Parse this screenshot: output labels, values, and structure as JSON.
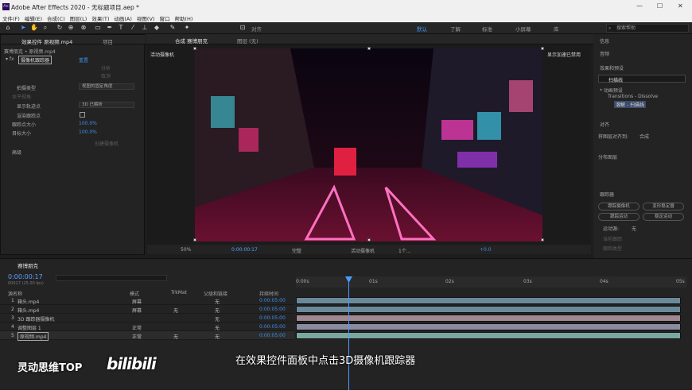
{
  "title": "Adobe After Effects 2020 - 无标题项目.aep *",
  "menu": [
    "文件(F)",
    "编辑(E)",
    "合成(C)",
    "图层(L)",
    "效果(T)",
    "动画(A)",
    "视图(V)",
    "窗口",
    "帮助(H)"
  ],
  "workspaces": [
    "默认",
    "了解",
    "标准",
    "小屏幕",
    "库"
  ],
  "search_placeholder": "搜索帮助",
  "toolbar_labels": {
    "align": "对齐"
  },
  "left_panel": {
    "tab_effects": "效果控件 原视频.mp4",
    "tab_project": "项目",
    "breadcrumb": "赛博朋克 • 原视频.mp4",
    "fx_name": "摄像机跟踪器",
    "reset": "重置",
    "lbl_analyze": "分析",
    "lbl_cancel": "取消",
    "lbl_shoot_type": "拍摄类型",
    "val_shoot_type": "视图的固定角度",
    "lbl_h_view": "水平视角",
    "lbl_show_points": "显示轨迹点",
    "val_show_points": "3D 已解析",
    "lbl_render_points": "渲染跟踪点",
    "lbl_point_size": "跟踪点大小",
    "val_point_size": "100.0%",
    "lbl_target_size": "目标大小",
    "val_target_size": "100.0%",
    "lbl_create_cam": "创建摄像机",
    "lbl_advanced": "高级"
  },
  "viewer": {
    "tab_comp": "合成 赛博朋克",
    "tab_layer": "图层 (无)",
    "camera_label": "活动摄像机",
    "accel_note": "显示加速已禁用",
    "zoom": "50%",
    "timecode": "0:00:00:17",
    "quality": "完整",
    "camera": "活动摄像机",
    "views": "1个...",
    "exposure": "+0.0"
  },
  "right_panel": {
    "info": "信息",
    "audio": "音频",
    "effects_presets": "效果和预设",
    "search_value": "扫描线",
    "tree_root": "* 动画预设",
    "tree_folder": "Transitions - Dissolve",
    "tree_item": "溶解 - 扫描线",
    "align": "对齐",
    "align_to_label": "将图层对齐到:",
    "align_to_value": "合成",
    "distribute": "分布图层",
    "tracker": "跟踪器",
    "btn_track_camera": "跟踪摄像机",
    "btn_warp_stabilizer": "变形稳定器",
    "btn_track_motion": "跟踪运动",
    "btn_stabilize_motion": "稳定运动",
    "motion_source_label": "运动源:",
    "motion_source_value": "无",
    "current_track_label": "当前跟踪",
    "track_type_label": "跟踪类型"
  },
  "timeline": {
    "tab": "赛博朋克",
    "timecode": "0:00:00:17",
    "fps_note": "00017 (25.00 fps)",
    "col_source": "源名称",
    "col_mode": "模式",
    "col_trkmat": "TrkMat",
    "col_parent": "父级和链接",
    "col_duration": "持续时间",
    "ruler": [
      "0:00s",
      "01s",
      "02s",
      "03s",
      "04s",
      "05s"
    ],
    "layers": [
      {
        "num": "1",
        "name": "箱头.mp4",
        "mode": "屏幕",
        "trk": "",
        "parent": "无",
        "dur": "0:00:05:00",
        "color": "#6a8a9a"
      },
      {
        "num": "2",
        "name": "箱头.mp4",
        "mode": "屏幕",
        "trk": "无",
        "parent": "无",
        "dur": "0:00:05:00",
        "color": "#6a8a9a"
      },
      {
        "num": "3",
        "name": "3D 跟踪器摄像机",
        "mode": "",
        "trk": "",
        "parent": "无",
        "dur": "0:00:05:00",
        "color": "#a08890"
      },
      {
        "num": "4",
        "name": "调整图层 1",
        "mode": "正常",
        "trk": "",
        "parent": "无",
        "dur": "0:00:05:00",
        "color": "#8a8aa0"
      },
      {
        "num": "5",
        "name": "原视频.mp4",
        "mode": "正常",
        "trk": "无",
        "parent": "无",
        "dur": "0:00:05:00",
        "color": "#7aa8a0"
      }
    ]
  },
  "overlay": {
    "subtitle": "在效果控件面板中点击3D摄像机跟踪器",
    "watermark": "灵动思维TOP",
    "bili": "bilibili"
  }
}
